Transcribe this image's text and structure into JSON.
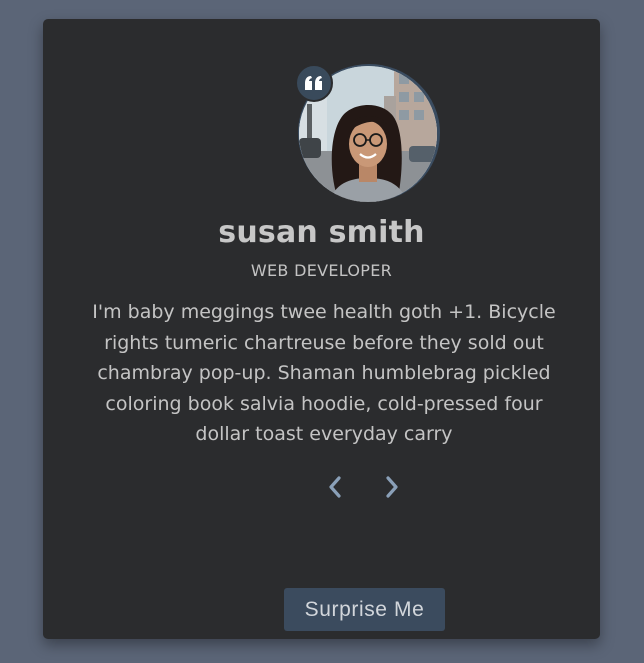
{
  "person": {
    "name": "susan smith",
    "job": "WEB DEVELOPER",
    "text": "I'm baby meggings twee health goth +1. Bicycle rights tumeric chartreuse before they sold out chambray pop-up. Shaman humblebrag pickled coloring book salvia hoodie, cold-pressed four dollar toast everyday carry"
  },
  "controls": {
    "prev_icon": "chevron-left-icon",
    "next_icon": "chevron-right-icon",
    "surprise_label": "Surprise Me"
  },
  "icons": {
    "quote": "quote-icon"
  },
  "colors": {
    "page_bg": "#5b6577",
    "card_bg": "#2b2c2e",
    "accent": "#3b4b5e",
    "chevron": "#8aa0b8"
  }
}
